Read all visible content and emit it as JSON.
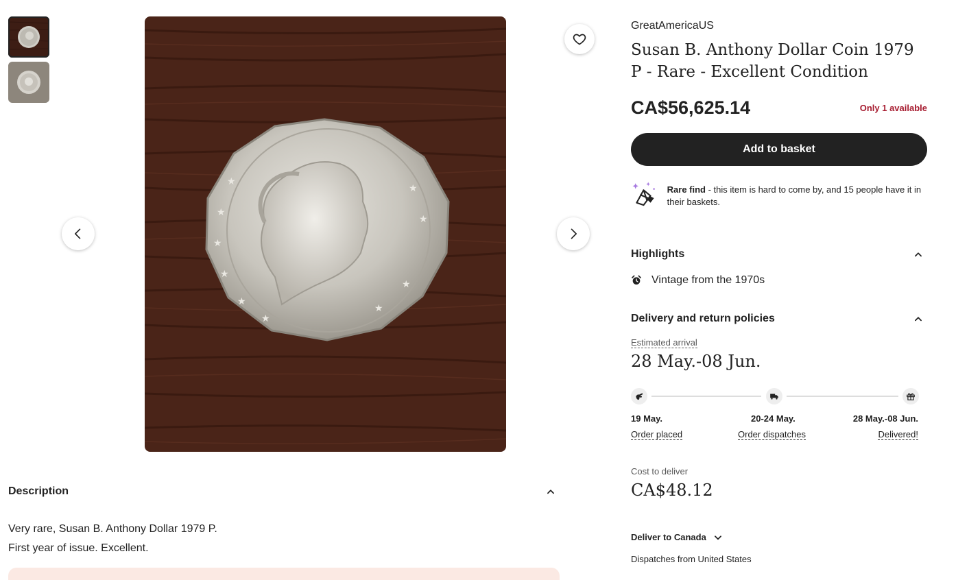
{
  "gallery": {
    "thumbnails": [
      {
        "alt": "coin-thumbnail-1"
      },
      {
        "alt": "coin-thumbnail-2"
      }
    ],
    "icons": {
      "favorite": "heart-icon",
      "prev": "chevron-left-icon",
      "next": "chevron-right-icon"
    }
  },
  "description": {
    "title": "Description",
    "line1": "Very rare, Susan B. Anthony Dollar 1979 P.",
    "line2": "First year of issue. Excellent."
  },
  "listing": {
    "shop_name": "GreatAmericaUS",
    "title": "Susan B. Anthony Dollar Coin 1979 P - Rare - Excellent Condition",
    "price": "CA$56,625.14",
    "stock": "Only 1 available",
    "add_to_basket": "Add to basket",
    "rare_find": {
      "bold": "Rare find",
      "text": " - this item is hard to come by, and 15 people have it in their baskets."
    }
  },
  "highlights": {
    "title": "Highlights",
    "item": "Vintage from the 1970s"
  },
  "delivery": {
    "title": "Delivery and return policies",
    "est_label": "Estimated arrival",
    "est_date": "28 May.-08 Jun.",
    "timeline": [
      {
        "date": "19 May.",
        "label": "Order placed",
        "icon": "hand-icon"
      },
      {
        "date": "20-24 May.",
        "label": "Order dispatches",
        "icon": "truck-icon"
      },
      {
        "date": "28 May.-08 Jun.",
        "label": "Delivered!",
        "icon": "gift-icon"
      }
    ],
    "cost_label": "Cost to deliver",
    "cost_value": "CA$48.12",
    "deliver_to": "Deliver to Canada",
    "dispatches_from": "Dispatches from United States"
  },
  "colors": {
    "button_bg": "#222222",
    "stock_red": "#a61a2e",
    "promo_bg": "#fbe9e3",
    "wood": "#4a2418"
  }
}
